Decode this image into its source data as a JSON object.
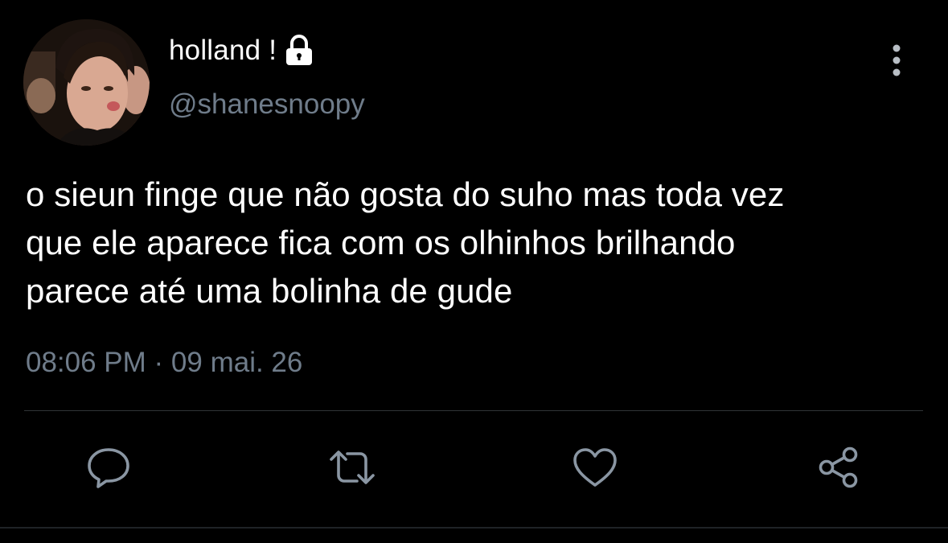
{
  "user": {
    "display_name": "holland !",
    "username": "@shanesnoopy",
    "protected_icon": "lock-icon",
    "avatar": "profile-photo"
  },
  "tweet": {
    "lines": [
      "o sieun finge que não gosta do suho mas toda vez",
      "que ele aparece fica com os olhinhos brilhando",
      "parece até uma bolinha de gude"
    ],
    "timestamp": "08:06 PM · 09 mai. 26"
  },
  "actions": [
    {
      "icon": "reply-icon"
    },
    {
      "icon": "retweet-icon"
    },
    {
      "icon": "like-icon"
    },
    {
      "icon": "share-icon"
    }
  ],
  "menu_icon": "more-vertical-icon",
  "colors": {
    "background": "#000000",
    "text": "#ffffff",
    "secondary": "#6f7c8a",
    "divider": "#2f3336"
  }
}
